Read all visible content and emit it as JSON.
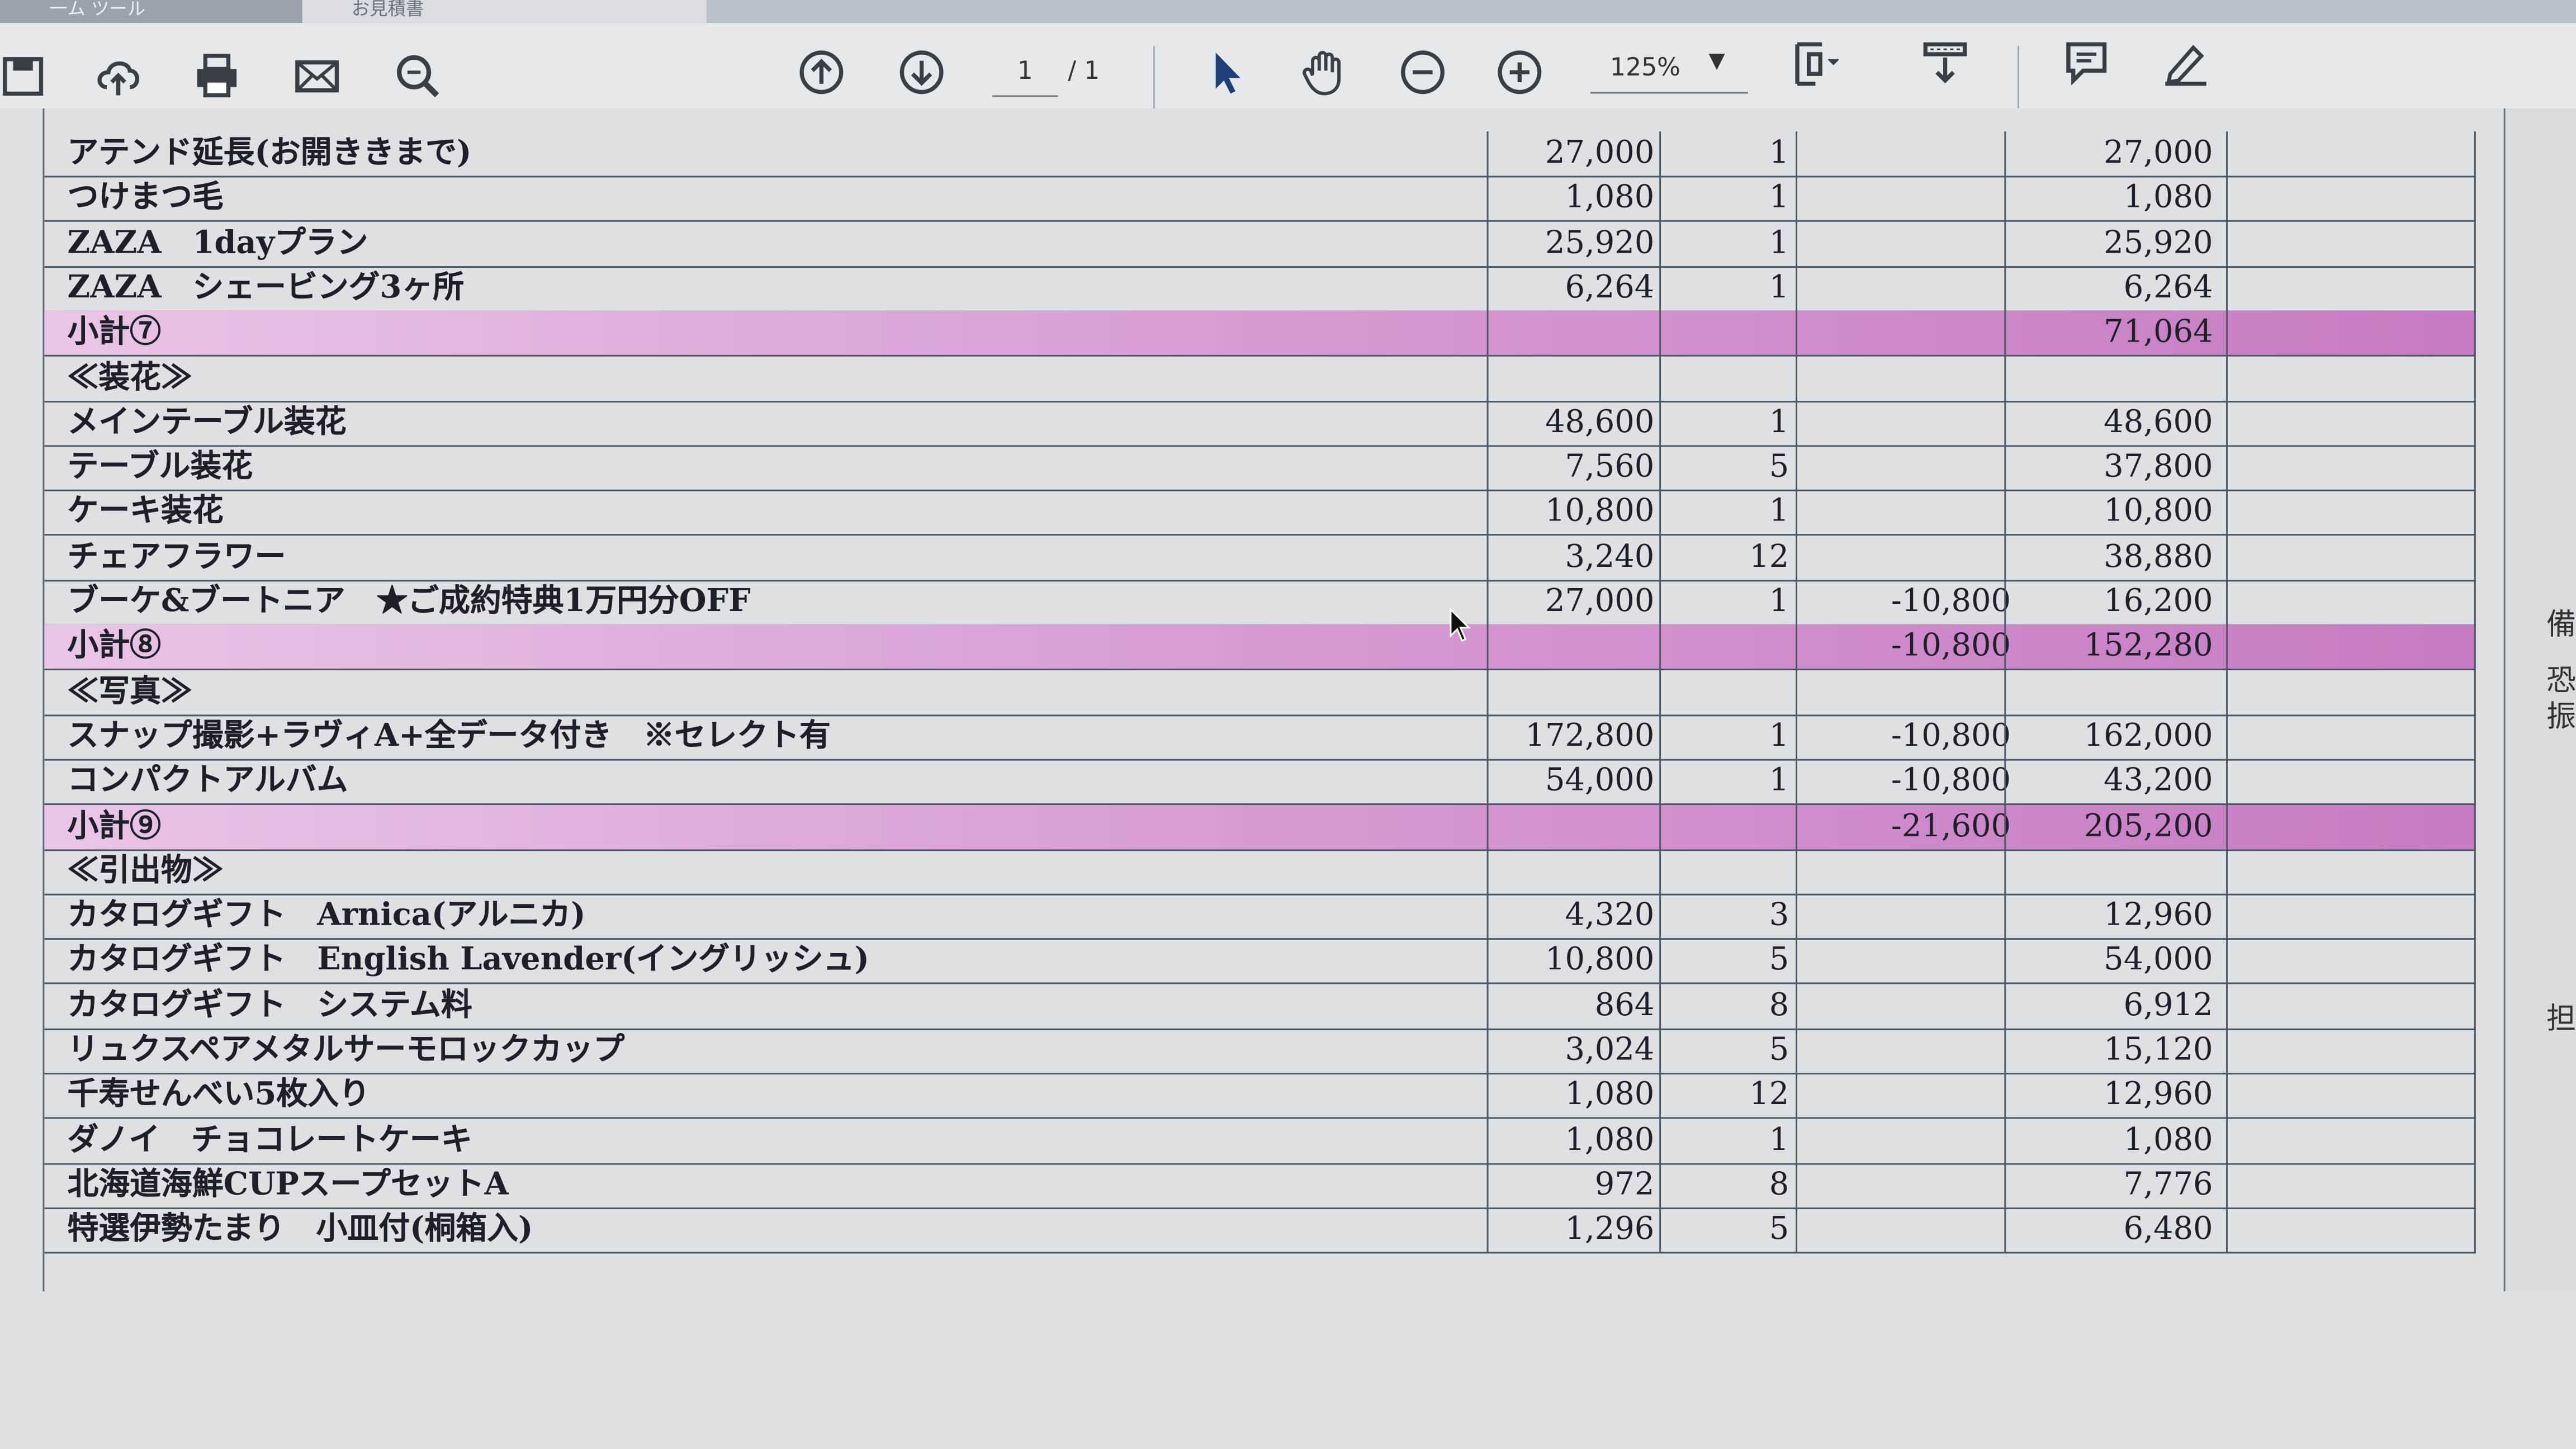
{
  "tabs": {
    "tab1": "一ム ツール",
    "tab2": "お見積書"
  },
  "toolbar": {
    "page_current": "1",
    "page_total": "/ 1",
    "zoom": "125%",
    "zoom_arrow": "▼",
    "icons": [
      "save-icon",
      "cloud-upload-icon",
      "print-icon",
      "mail-icon",
      "zoom-search-icon",
      "prev-page-icon",
      "next-page-icon",
      "select-arrow-icon",
      "hand-tool-icon",
      "zoom-out-icon",
      "zoom-in-icon",
      "fit-page-icon",
      "scroll-mode-icon",
      "comment-icon",
      "sign-pen-icon"
    ]
  },
  "table": {
    "rows": [
      {
        "name": "アテンド延長(お開ききまで)",
        "price": "27,000",
        "qty": "1",
        "disc": "",
        "total": "27,000",
        "type": "item"
      },
      {
        "name": "つけまつ毛",
        "price": "1,080",
        "qty": "1",
        "disc": "",
        "total": "1,080",
        "type": "item"
      },
      {
        "name": "ZAZA　1dayプラン",
        "price": "25,920",
        "qty": "1",
        "disc": "",
        "total": "25,920",
        "type": "item"
      },
      {
        "name": "ZAZA　シェービング3ヶ所",
        "price": "6,264",
        "qty": "1",
        "disc": "",
        "total": "6,264",
        "type": "item"
      },
      {
        "name": "小計⑦",
        "price": "",
        "qty": "",
        "disc": "",
        "total": "71,064",
        "type": "subtotal"
      },
      {
        "name": "≪装花≫",
        "price": "",
        "qty": "",
        "disc": "",
        "total": "",
        "type": "header"
      },
      {
        "name": "メインテーブル装花",
        "price": "48,600",
        "qty": "1",
        "disc": "",
        "total": "48,600",
        "type": "item"
      },
      {
        "name": "テーブル装花",
        "price": "7,560",
        "qty": "5",
        "disc": "",
        "total": "37,800",
        "type": "item"
      },
      {
        "name": "ケーキ装花",
        "price": "10,800",
        "qty": "1",
        "disc": "",
        "total": "10,800",
        "type": "item"
      },
      {
        "name": "チェアフラワー",
        "price": "3,240",
        "qty": "12",
        "disc": "",
        "total": "38,880",
        "type": "item"
      },
      {
        "name": "ブーケ&ブートニア　★ご成約特典1万円分OFF",
        "price": "27,000",
        "qty": "1",
        "disc": "-10,800",
        "total": "16,200",
        "type": "item"
      },
      {
        "name": "小計⑧",
        "price": "",
        "qty": "",
        "disc": "-10,800",
        "total": "152,280",
        "type": "subtotal"
      },
      {
        "name": "≪写真≫",
        "price": "",
        "qty": "",
        "disc": "",
        "total": "",
        "type": "header"
      },
      {
        "name": "スナップ撮影+ラヴィA+全データ付き　※セレクト有",
        "price": "172,800",
        "qty": "1",
        "disc": "-10,800",
        "total": "162,000",
        "type": "item"
      },
      {
        "name": "コンパクトアルバム",
        "price": "54,000",
        "qty": "1",
        "disc": "-10,800",
        "total": "43,200",
        "type": "item"
      },
      {
        "name": "小計⑨",
        "price": "",
        "qty": "",
        "disc": "-21,600",
        "total": "205,200",
        "type": "subtotal"
      },
      {
        "name": "≪引出物≫",
        "price": "",
        "qty": "",
        "disc": "",
        "total": "",
        "type": "header"
      },
      {
        "name": "カタログギフト　Arnica(アルニカ)",
        "price": "4,320",
        "qty": "3",
        "disc": "",
        "total": "12,960",
        "type": "item"
      },
      {
        "name": "カタログギフト　English Lavender(イングリッシュ)",
        "price": "10,800",
        "qty": "5",
        "disc": "",
        "total": "54,000",
        "type": "item"
      },
      {
        "name": "カタログギフト　システム料",
        "price": "864",
        "qty": "8",
        "disc": "",
        "total": "6,912",
        "type": "item"
      },
      {
        "name": "リュクスペアメタルサーモロックカップ",
        "price": "3,024",
        "qty": "5",
        "disc": "",
        "total": "15,120",
        "type": "item"
      },
      {
        "name": "千寿せんべい5枚入り",
        "price": "1,080",
        "qty": "12",
        "disc": "",
        "total": "12,960",
        "type": "item"
      },
      {
        "name": "ダノイ　チョコレートケーキ",
        "price": "1,080",
        "qty": "1",
        "disc": "",
        "total": "1,080",
        "type": "item"
      },
      {
        "name": "北海道海鮮CUPスープセットA",
        "price": "972",
        "qty": "8",
        "disc": "",
        "total": "7,776",
        "type": "item"
      },
      {
        "name": "特選伊勢たまり　小皿付(桐箱入)",
        "price": "1,296",
        "qty": "5",
        "disc": "",
        "total": "6,480",
        "type": "item"
      }
    ]
  },
  "side": {
    "c1": "備",
    "c2": "恐",
    "c3": "振",
    "c4": "担"
  },
  "colors": {
    "subtotal_purple": "#c67bc2",
    "grid": "#4b5764",
    "toolbar_bg": "#e6e9ec",
    "page_bg": "#dde1e3"
  }
}
